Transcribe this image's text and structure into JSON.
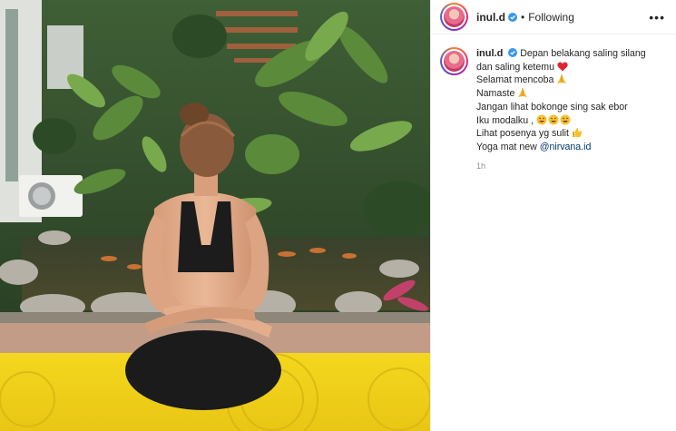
{
  "post": {
    "username": "inul.d",
    "header": {
      "separator": "•",
      "follow_state": "Following",
      "more_label": "•••"
    },
    "caption": {
      "first_line": "Depan belakang saling silang",
      "lines": [
        "dan saling ketemu",
        "Selamat mencoba",
        "Namaste",
        "Jangan lihat bokonge sing sak ebor",
        "Iku modalku ,",
        "Lihat posenya yg sulit",
        "Yoga mat new "
      ],
      "mention": "@nirvana.id"
    },
    "timestamp": "1h"
  },
  "icons": {
    "verified": "verified-badge-icon",
    "heart": "red-heart-emoji",
    "pray": "folded-hands-emoji",
    "laugh": "rolling-laughing-emoji",
    "thumbs": "thumbs-up-emoji",
    "more": "more-options-icon"
  },
  "colors": {
    "verified_blue": "#3897f0",
    "mention": "#00376b",
    "mat_yellow": "#f2d21b",
    "timestamp": "#8e8e8e"
  }
}
